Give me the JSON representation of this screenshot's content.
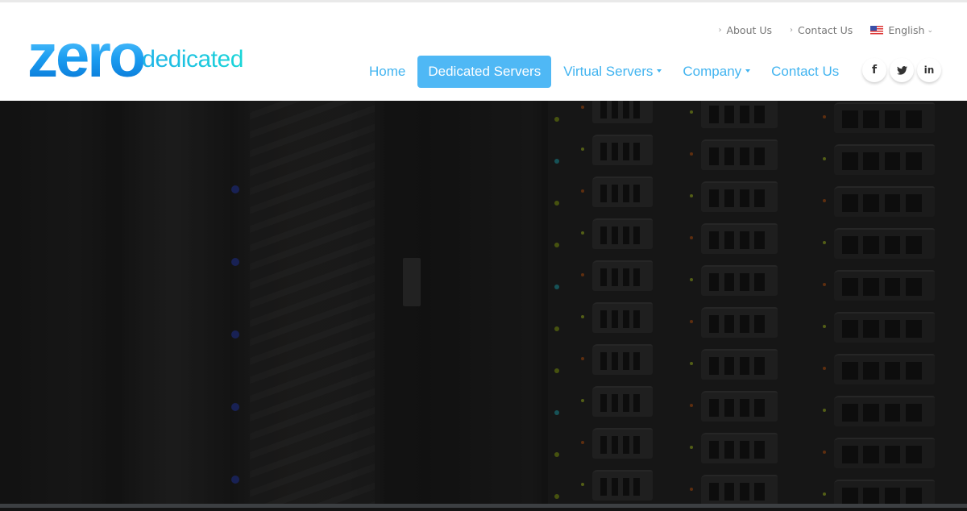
{
  "brand": {
    "logo_main": "zero",
    "logo_sub": "dedicated",
    "primary_color": "#42b4f0",
    "accent_color": "#1ad6d8"
  },
  "topnav": {
    "items": [
      {
        "label": "About Us",
        "icon": "chevron-right-icon"
      },
      {
        "label": "Contact Us",
        "icon": "chevron-right-icon"
      }
    ],
    "language": {
      "label": "English",
      "icon": "us-flag-icon",
      "caret": "chevron-down-icon"
    }
  },
  "mainnav": {
    "items": [
      {
        "label": "Home",
        "active": false,
        "dropdown": false
      },
      {
        "label": "Dedicated Servers",
        "active": true,
        "dropdown": false
      },
      {
        "label": "Virtual Servers",
        "active": false,
        "dropdown": true
      },
      {
        "label": "Company",
        "active": false,
        "dropdown": true
      },
      {
        "label": "Contact Us",
        "active": false,
        "dropdown": false
      }
    ],
    "active_bg": "#4fb8f5"
  },
  "social": [
    {
      "name": "facebook",
      "glyph": "f",
      "icon": "facebook-icon"
    },
    {
      "name": "twitter",
      "glyph": "",
      "icon": "twitter-icon"
    },
    {
      "name": "linkedin",
      "glyph": "in",
      "icon": "linkedin-icon"
    }
  ],
  "hero": {
    "image": "server-rack-photo",
    "overlay": "dark"
  }
}
